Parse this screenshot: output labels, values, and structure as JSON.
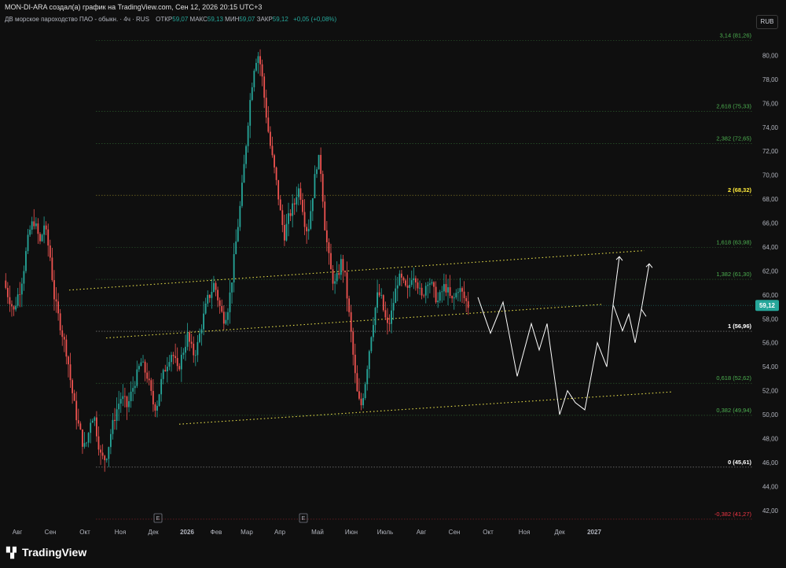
{
  "header": {
    "caption": "MON-DI-ARA создал(а) график на TradingView.com, Сен 12, 2026 20:15 UTC+3",
    "symbol": "ДВ морское пароходство ПАО - обыкн. · 4ч · RUS",
    "ohlc": [
      {
        "label": "ОТКР",
        "value": "59,07"
      },
      {
        "label": "МАКС",
        "value": "59,13"
      },
      {
        "label": "МИН",
        "value": "59,07"
      },
      {
        "label": "ЗАКР",
        "value": "59,12"
      }
    ],
    "change": "+0,05 (+0,08%)",
    "currency": "RUB"
  },
  "footer": {
    "logo_text": "TradingView",
    "logo_icon": "tradingview-logo-icon"
  },
  "colors": {
    "background": "#0f0f0f",
    "up": "#26a69a",
    "down": "#ef5350",
    "fib_green": "#4caf50",
    "fib_gold": "#ffeb3b",
    "fib_red": "#f23645",
    "channel": "#e8e04a",
    "projection": "#ffffff",
    "price_badge": "#26a69a"
  },
  "chart_data": {
    "type": "candlestick",
    "ylim": [
      41,
      82
    ],
    "y_ticks": [
      "42,00",
      "44,00",
      "46,00",
      "48,00",
      "50,00",
      "52,00",
      "54,00",
      "56,00",
      "58,00",
      "60,00",
      "62,00",
      "64,00",
      "66,00",
      "68,00",
      "70,00",
      "72,00",
      "74,00",
      "76,00",
      "78,00",
      "80,00"
    ],
    "x_ticks": [
      "Авг",
      "Сен",
      "Окт",
      "Ноя",
      "Дек",
      "2026",
      "Фев",
      "Мар",
      "Апр",
      "Май",
      "Июн",
      "Июль",
      "Авг",
      "Сен",
      "Окт",
      "Ноя",
      "Дек",
      "2027"
    ],
    "last_price": {
      "value": 59.12,
      "label": "59,12"
    },
    "fib_levels": [
      {
        "label": "3,14 (81,26)",
        "value": 81.26,
        "color": "#4caf50"
      },
      {
        "label": "2,618 (75,33)",
        "value": 75.33,
        "color": "#4caf50"
      },
      {
        "label": "2,382 (72,65)",
        "value": 72.65,
        "color": "#4caf50"
      },
      {
        "label": "2 (68,32)",
        "value": 68.32,
        "color": "#ffeb3b"
      },
      {
        "label": "1,618 (63,98)",
        "value": 63.98,
        "color": "#4caf50"
      },
      {
        "label": "1,382 (61,30)",
        "value": 61.3,
        "color": "#4caf50"
      },
      {
        "label": "1 (56,96)",
        "value": 56.96,
        "color": "#ffffff"
      },
      {
        "label": "0,618 (52,62)",
        "value": 52.62,
        "color": "#4caf50"
      },
      {
        "label": "0,382 (49,94)",
        "value": 49.94,
        "color": "#4caf50"
      },
      {
        "label": "0 (45,61)",
        "value": 45.61,
        "color": "#ffffff"
      },
      {
        "label": "-0,382 (41,27)",
        "value": 41.27,
        "color": "#f23645"
      }
    ],
    "event_markers": [
      "E",
      "E"
    ],
    "price_path": [
      [
        0,
        61.2
      ],
      [
        3,
        60.2
      ],
      [
        6,
        59.5
      ],
      [
        9,
        58.6
      ],
      [
        12,
        59.8
      ],
      [
        15,
        60.6
      ],
      [
        18,
        62.2
      ],
      [
        21,
        64.2
      ],
      [
        24,
        65.6
      ],
      [
        27,
        66.2
      ],
      [
        30,
        65.3
      ],
      [
        33,
        64.2
      ],
      [
        36,
        66.0
      ],
      [
        39,
        64.6
      ],
      [
        42,
        63.0
      ],
      [
        45,
        60.0
      ],
      [
        48,
        58.6
      ],
      [
        51,
        57.4
      ],
      [
        54,
        56.2
      ],
      [
        57,
        55.0
      ],
      [
        60,
        52.8
      ],
      [
        63,
        51.0
      ],
      [
        66,
        49.5
      ],
      [
        69,
        48.4
      ],
      [
        72,
        47.2
      ],
      [
        75,
        47.8
      ],
      [
        78,
        49.6
      ],
      [
        81,
        50.0
      ],
      [
        84,
        48.2
      ],
      [
        87,
        46.6
      ],
      [
        90,
        46.2
      ],
      [
        93,
        46.8
      ],
      [
        96,
        48.4
      ],
      [
        99,
        49.6
      ],
      [
        102,
        50.6
      ],
      [
        105,
        51.4
      ],
      [
        108,
        51.2
      ],
      [
        111,
        50.6
      ],
      [
        114,
        51.6
      ],
      [
        117,
        52.6
      ],
      [
        120,
        53.4
      ],
      [
        123,
        54.4
      ],
      [
        126,
        53.8
      ],
      [
        129,
        53.2
      ],
      [
        132,
        51.8
      ],
      [
        135,
        50.6
      ],
      [
        138,
        51.0
      ],
      [
        141,
        52.6
      ],
      [
        144,
        53.6
      ],
      [
        147,
        54.4
      ],
      [
        150,
        55.2
      ],
      [
        153,
        54.8
      ],
      [
        156,
        53.6
      ],
      [
        159,
        54.6
      ],
      [
        162,
        55.6
      ],
      [
        165,
        56.6
      ],
      [
        168,
        55.6
      ],
      [
        171,
        55.0
      ],
      [
        174,
        55.8
      ],
      [
        177,
        57.2
      ],
      [
        180,
        58.4
      ],
      [
        183,
        59.6
      ],
      [
        186,
        60.2
      ],
      [
        189,
        61.0
      ],
      [
        192,
        59.8
      ],
      [
        195,
        58.6
      ],
      [
        198,
        58.0
      ],
      [
        201,
        58.8
      ],
      [
        204,
        60.6
      ],
      [
        207,
        63.2
      ],
      [
        210,
        65.6
      ],
      [
        213,
        68.0
      ],
      [
        216,
        71.0
      ],
      [
        219,
        74.2
      ],
      [
        222,
        77.0
      ],
      [
        225,
        79.2
      ],
      [
        228,
        80.2
      ],
      [
        231,
        79.0
      ],
      [
        234,
        76.4
      ],
      [
        237,
        74.0
      ],
      [
        240,
        72.0
      ],
      [
        243,
        70.4
      ],
      [
        246,
        68.6
      ],
      [
        249,
        66.4
      ],
      [
        252,
        65.0
      ],
      [
        255,
        66.2
      ],
      [
        258,
        67.0
      ],
      [
        261,
        67.6
      ],
      [
        264,
        69.0
      ],
      [
        267,
        68.2
      ],
      [
        270,
        66.2
      ],
      [
        273,
        65.2
      ],
      [
        276,
        67.4
      ],
      [
        279,
        69.6
      ],
      [
        282,
        71.6
      ],
      [
        285,
        70.2
      ],
      [
        288,
        66.0
      ],
      [
        291,
        63.6
      ],
      [
        294,
        61.8
      ],
      [
        297,
        60.8
      ],
      [
        300,
        61.6
      ],
      [
        303,
        62.8
      ],
      [
        306,
        61.8
      ],
      [
        309,
        59.2
      ],
      [
        312,
        56.6
      ],
      [
        315,
        53.6
      ],
      [
        318,
        51.2
      ],
      [
        321,
        50.8
      ],
      [
        324,
        52.4
      ],
      [
        327,
        54.6
      ],
      [
        330,
        56.8
      ],
      [
        333,
        58.6
      ],
      [
        336,
        60.2
      ],
      [
        339,
        59.6
      ],
      [
        342,
        58.2
      ],
      [
        345,
        57.2
      ],
      [
        348,
        58.4
      ],
      [
        351,
        60.0
      ],
      [
        354,
        61.4
      ],
      [
        357,
        61.2
      ],
      [
        360,
        60.6
      ],
      [
        363,
        60.2
      ],
      [
        366,
        61.6
      ],
      [
        369,
        61.8
      ],
      [
        372,
        60.8
      ],
      [
        375,
        59.6
      ],
      [
        378,
        60.6
      ],
      [
        381,
        61.4
      ],
      [
        384,
        60.8
      ],
      [
        387,
        60.0
      ],
      [
        390,
        59.4
      ],
      [
        393,
        60.2
      ],
      [
        396,
        60.8
      ],
      [
        399,
        60.2
      ],
      [
        402,
        59.4
      ],
      [
        405,
        59.8
      ],
      [
        408,
        60.6
      ],
      [
        411,
        60.2
      ],
      [
        414,
        59.6
      ],
      [
        417,
        59.12
      ]
    ],
    "channels": [
      {
        "name": "",
        "points": [
          [
            88,
            60.4
          ],
          [
            820,
            63.7
          ]
        ]
      },
      {
        "name": "",
        "points": [
          [
            135,
            56.4
          ],
          [
            765,
            59.2
          ]
        ]
      },
      {
        "name": "",
        "points": [
          [
            228,
            49.2
          ],
          [
            855,
            51.9
          ]
        ]
      }
    ],
    "projection": [
      [
        608,
        59.8
      ],
      [
        624,
        56.8
      ],
      [
        640,
        59.4
      ],
      [
        658,
        53.2
      ],
      [
        676,
        57.6
      ],
      [
        686,
        55.4
      ],
      [
        696,
        57.6
      ],
      [
        712,
        50.0
      ],
      [
        722,
        52.0
      ],
      [
        732,
        51.0
      ],
      [
        744,
        50.4
      ],
      [
        760,
        56.0
      ],
      [
        772,
        54.0
      ],
      [
        780,
        59.2
      ],
      [
        792,
        57.0
      ],
      [
        800,
        58.4
      ],
      [
        808,
        56.0
      ],
      [
        816,
        58.8
      ],
      [
        822,
        58.2
      ]
    ],
    "projection_arrows": [
      [
        [
          780,
          59.2
        ],
        [
          788,
          63.2
        ]
      ],
      [
        [
          816,
          58.8
        ],
        [
          826,
          62.6
        ]
      ]
    ]
  }
}
